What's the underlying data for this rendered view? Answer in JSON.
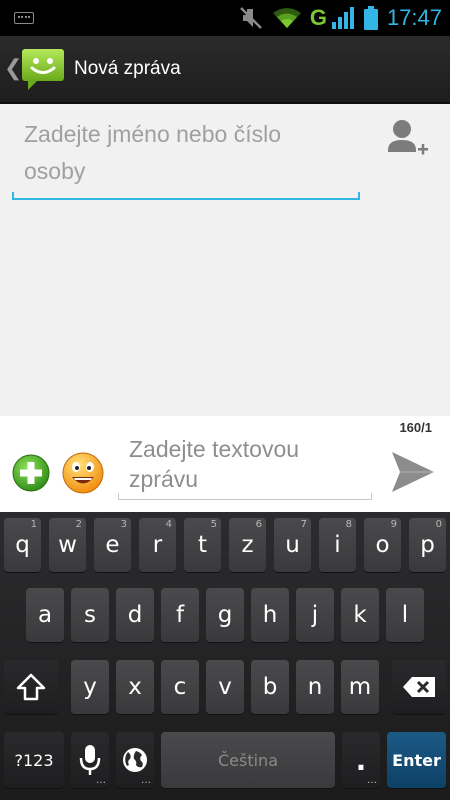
{
  "status_bar": {
    "clock": "17:47",
    "network_type": "G",
    "icons": [
      "keyboard-icon",
      "mute-icon",
      "wifi-icon",
      "signal-icon",
      "battery-icon"
    ]
  },
  "action_bar": {
    "title": "Nová zpráva",
    "back_glyph": "❮",
    "app_icon": "messaging-smiley-icon"
  },
  "recipient": {
    "placeholder_line1": "Zadejte jméno nebo číslo",
    "placeholder_line2": "osoby"
  },
  "compose": {
    "counter": "160/1",
    "placeholder_line1": "Zadejte textovou",
    "placeholder_line2": "zprávu"
  },
  "keyboard": {
    "row1": [
      {
        "label": "q",
        "hint": "1"
      },
      {
        "label": "w",
        "hint": "2"
      },
      {
        "label": "e",
        "hint": "3"
      },
      {
        "label": "r",
        "hint": "4"
      },
      {
        "label": "t",
        "hint": "5"
      },
      {
        "label": "z",
        "hint": "6"
      },
      {
        "label": "u",
        "hint": "7"
      },
      {
        "label": "i",
        "hint": "8"
      },
      {
        "label": "o",
        "hint": "9"
      },
      {
        "label": "p",
        "hint": "0"
      }
    ],
    "row2": [
      "a",
      "s",
      "d",
      "f",
      "g",
      "h",
      "j",
      "k",
      "l"
    ],
    "row3": [
      "y",
      "x",
      "c",
      "v",
      "b",
      "n",
      "m"
    ],
    "symbols_label": "?123",
    "space_label": "Čeština",
    "period_label": ".",
    "enter_label": "Enter",
    "more_dots": "…"
  },
  "colors": {
    "accent": "#33b5e5",
    "enter_key": "#1b5a86",
    "wifi": "#7bc832"
  }
}
